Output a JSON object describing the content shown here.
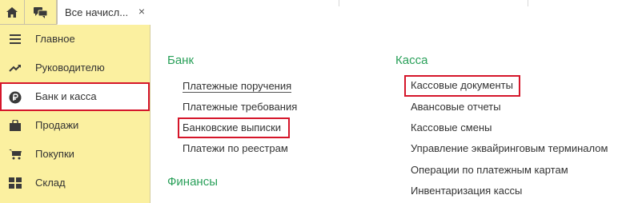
{
  "topbar": {
    "tab_title": "Все начисл...",
    "close_glyph": "×"
  },
  "sidebar": {
    "items": [
      {
        "label": "Главное",
        "icon": "hamburger-icon"
      },
      {
        "label": "Руководителю",
        "icon": "trend-up-icon"
      },
      {
        "label": "Банк и касса",
        "icon": "ruble-coin-icon"
      },
      {
        "label": "Продажи",
        "icon": "shopping-bag-icon"
      },
      {
        "label": "Покупки",
        "icon": "shopping-cart-icon"
      },
      {
        "label": "Склад",
        "icon": "warehouse-grid-icon"
      }
    ]
  },
  "main": {
    "bank": {
      "title": "Банк",
      "links": [
        "Платежные поручения",
        "Платежные требования",
        "Банковские выписки",
        "Платежи по реестрам"
      ]
    },
    "finance": {
      "title": "Финансы"
    },
    "cash": {
      "title": "Касса",
      "links": [
        "Кассовые документы",
        "Авансовые отчеты",
        "Кассовые смены",
        "Управление эквайринговым терминалом",
        "Операции по платежным картам",
        "Инвентаризация кассы"
      ]
    }
  },
  "colors": {
    "sidebar_bg": "#fbf0a0",
    "section_title": "#2aa05a",
    "highlight": "#d5162a",
    "text": "#333333"
  }
}
